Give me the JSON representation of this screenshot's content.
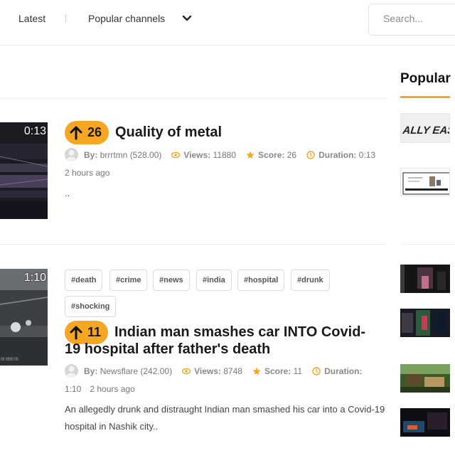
{
  "nav": {
    "latest": "Latest",
    "popular_channels": "Popular channels",
    "search_placeholder": "Search..."
  },
  "sidebar": {
    "title": "Popular",
    "thumb1_text": "ALLY EASY"
  },
  "posts": [
    {
      "votes": "26",
      "title": "Quality of metal",
      "duration_overlay": "0:13",
      "by_label": "By:",
      "author": "brrrtmn (528.00)",
      "views_label": "Views:",
      "views": "11880",
      "score_label": "Score:",
      "score": "26",
      "duration_label": "Duration:",
      "duration": "0:13",
      "time": "2 hours ago",
      "description": ".."
    },
    {
      "votes": "11",
      "title_line1": "Indian man smashes car INTO Covid-",
      "title_line2": "19 hospital after father's death",
      "duration_overlay": "1:10",
      "tags": [
        "#death",
        "#crime",
        "#news",
        "#india",
        "#hospital",
        "#drunk",
        "#shocking"
      ],
      "by_label": "By:",
      "author": "Newsflare (242.00)",
      "views_label": "Views:",
      "views": "8748",
      "score_label": "Score:",
      "score": "11",
      "duration_label": "Duration:",
      "duration": "1:10",
      "time": "2 hours ago",
      "description_line1": "An allegedly drunk and distraught Indian man smashed his car into a Covid-19",
      "description_line2": "hospital in Nashik city.."
    }
  ],
  "colors": {
    "accent": "#f5a623",
    "meta_icon": "#f5a623"
  }
}
